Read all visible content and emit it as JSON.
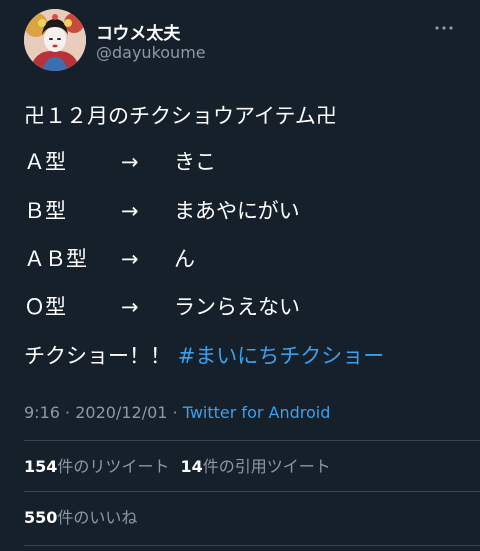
{
  "author": {
    "display_name": "コウメ太夫",
    "handle": "@dayukoume",
    "avatar_icon": "geisha-portrait-avatar"
  },
  "menu": {
    "icon": "more-options-icon"
  },
  "tweet": {
    "title_line": "卍１２月のチクショウアイテム卍",
    "rows": [
      {
        "type": "Ａ型",
        "arrow": "→",
        "result": "きこ"
      },
      {
        "type": "Ｂ型",
        "arrow": "→",
        "result": "まあやにがい"
      },
      {
        "type": "ＡＢ型",
        "arrow": "→",
        "result": "ん"
      },
      {
        "type": "Ｏ型",
        "arrow": "→",
        "result": "ランらえない"
      }
    ],
    "closing": "チクショー！！",
    "hashtag": "#まいにちチクショー"
  },
  "meta": {
    "time": "9:16",
    "separator": "·",
    "date": "2020/12/01",
    "source": "Twitter for Android"
  },
  "stats": {
    "retweets_count": "154",
    "retweets_label": "件のリツイート",
    "quotes_count": "14",
    "quotes_label": "件の引用ツイート",
    "likes_count": "550",
    "likes_label": "件のいいね"
  },
  "colors": {
    "background": "#15202b",
    "link": "#3b9fed",
    "secondary_text": "#8b98a5",
    "divider": "#38444d"
  }
}
